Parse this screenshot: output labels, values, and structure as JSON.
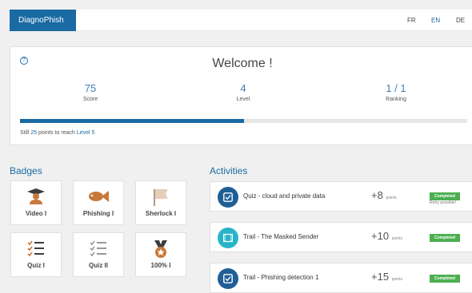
{
  "app": {
    "brand": "DiagnoPhish"
  },
  "languages": [
    {
      "code": "FR",
      "active": false
    },
    {
      "code": "EN",
      "active": true
    },
    {
      "code": "DE",
      "active": false
    }
  ],
  "welcome": {
    "title": "Welcome !",
    "stats": [
      {
        "value": "75",
        "label": "Score"
      },
      {
        "value": "4",
        "label": "Level"
      },
      {
        "value": "1 / 1",
        "label": "Ranking"
      }
    ],
    "progress_fraction": 0.5,
    "progress_note": {
      "prefix": "Still",
      "points": "25",
      "middle": "points to reach",
      "target": "Level 5"
    }
  },
  "badges": {
    "title": "Badges",
    "items": [
      {
        "label": "Video I",
        "icon": "graduate-icon"
      },
      {
        "label": "Phishing I",
        "icon": "fish-icon"
      },
      {
        "label": "Sherlock I",
        "icon": "flag-icon"
      },
      {
        "label": "Quiz I",
        "icon": "checklist-icon"
      },
      {
        "label": "Quiz II",
        "icon": "checklist-gray-icon"
      },
      {
        "label": "100% I",
        "icon": "medal-icon"
      }
    ]
  },
  "activities": {
    "title": "Activities",
    "items": [
      {
        "name": "Quiz - cloud and private data",
        "points": "+8",
        "points_unit": "points",
        "status": "Completed",
        "note": "Retry possible!",
        "icon": "checkbox-icon",
        "color": "#1f5f96"
      },
      {
        "name": "Trail - The Masked Sender",
        "points": "+10",
        "points_unit": "points",
        "status": "Completed",
        "note": "",
        "icon": "film-icon",
        "color": "#28b4c8"
      },
      {
        "name": "Trail - Phishing detection 1",
        "points": "+15",
        "points_unit": "points",
        "status": "Completed",
        "note": "",
        "icon": "checkbox-icon",
        "color": "#1f5f96"
      }
    ]
  },
  "colors": {
    "primary": "#1a6aa3",
    "completed": "#4caf50",
    "badge_accent": "#c8783a"
  }
}
